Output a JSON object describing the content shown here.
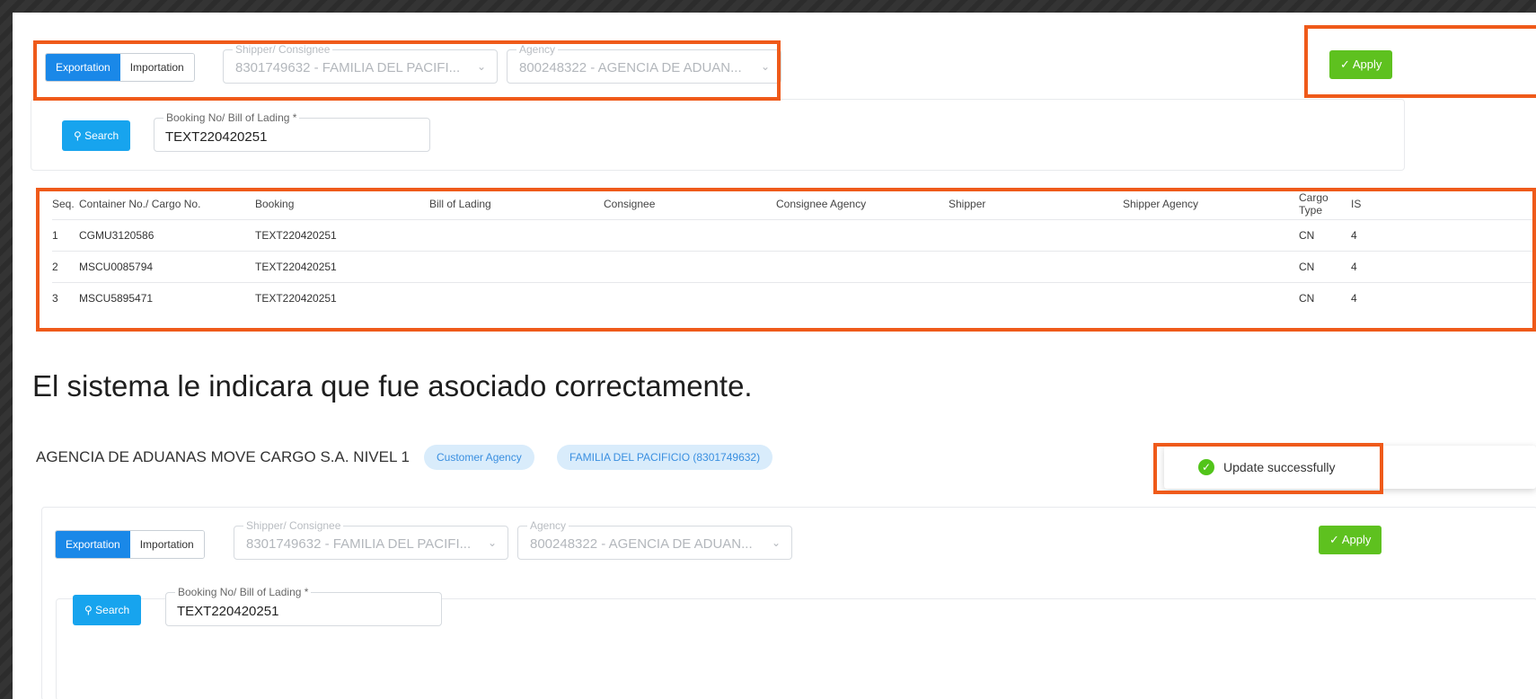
{
  "top": {
    "toggle": {
      "exportation": "Exportation",
      "importation": "Importation"
    },
    "shipper": {
      "label": "Shipper/ Consignee",
      "value": "8301749632 - FAMILIA DEL PACIFI..."
    },
    "agency": {
      "label": "Agency",
      "value": "800248322 - AGENCIA DE ADUAN..."
    },
    "apply": "Apply",
    "search": "Search",
    "booking": {
      "label": "Booking No/ Bill of Lading *",
      "value": "TEXT220420251"
    }
  },
  "table": {
    "headers": [
      "Seq.",
      "Container No./ Cargo No.",
      "Booking",
      "Bill of Lading",
      "Consignee",
      "Consignee Agency",
      "Shipper",
      "Shipper Agency",
      "Cargo Type",
      "IS"
    ],
    "rows": [
      [
        "1",
        "CGMU3120586",
        "TEXT220420251",
        "",
        "",
        "",
        "",
        "",
        "CN",
        "4"
      ],
      [
        "2",
        "MSCU0085794",
        "TEXT220420251",
        "",
        "",
        "",
        "",
        "",
        "CN",
        "4"
      ],
      [
        "3",
        "MSCU5895471",
        "TEXT220420251",
        "",
        "",
        "",
        "",
        "",
        "CN",
        "4"
      ]
    ]
  },
  "caption": "El sistema le indicara que fue asociado correctamente.",
  "bottom": {
    "title": "AGENCIA DE ADUANAS MOVE CARGO S.A. NIVEL 1",
    "pill1": "Customer Agency",
    "pill2": "FAMILIA DEL PACIFICIO (8301749632)",
    "toast": "Update successfully",
    "toggle": {
      "exportation": "Exportation",
      "importation": "Importation"
    },
    "shipper": {
      "label": "Shipper/ Consignee",
      "value": "8301749632 - FAMILIA DEL PACIFI..."
    },
    "agency": {
      "label": "Agency",
      "value": "800248322 - AGENCIA DE ADUAN..."
    },
    "apply": "Apply",
    "search": "Search",
    "booking": {
      "label": "Booking No/ Bill of Lading *",
      "value": "TEXT220420251"
    }
  },
  "colors": {
    "highlight": "#ef5a1a",
    "primary": "#1a88e8",
    "apply": "#5ec11f",
    "search": "#17a4ee",
    "success": "#52c41a"
  },
  "icons": {
    "apply": "check-icon",
    "search": "search-icon",
    "select": "chevron-down-icon",
    "toast": "check-circle-icon"
  }
}
